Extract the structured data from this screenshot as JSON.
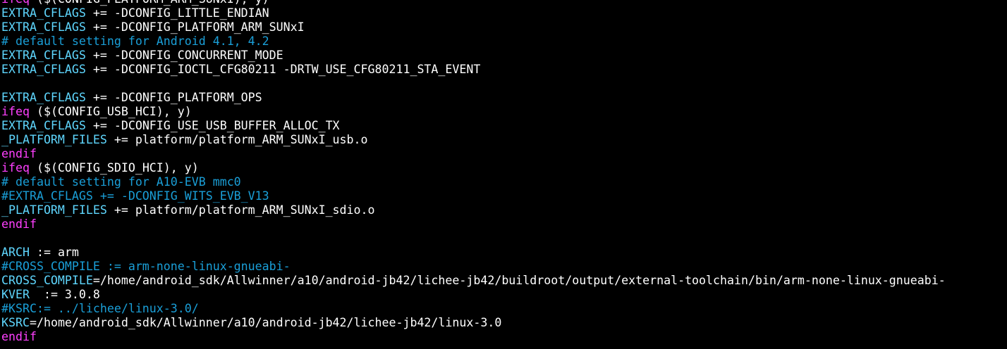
{
  "colors": {
    "background": "#000000",
    "keyword": "#ff40ff",
    "variable": "#5fd7ff",
    "text": "#ffffff",
    "comment": "#1a9fd8"
  },
  "lines": [
    {
      "type": "code",
      "segments": [
        {
          "c": "kw",
          "t": "ifeq"
        },
        {
          "c": "txt",
          "t": " ($(CONFIG_PLATFORM_ARM_SUNxI), y)"
        }
      ]
    },
    {
      "type": "code",
      "segments": [
        {
          "c": "var",
          "t": "EXTRA_CFLAGS"
        },
        {
          "c": "op",
          "t": " += "
        },
        {
          "c": "txt",
          "t": "-DCONFIG_LITTLE_ENDIAN"
        }
      ]
    },
    {
      "type": "code",
      "segments": [
        {
          "c": "var",
          "t": "EXTRA_CFLAGS"
        },
        {
          "c": "op",
          "t": " += "
        },
        {
          "c": "txt",
          "t": "-DCONFIG_PLATFORM_ARM_SUNxI"
        }
      ]
    },
    {
      "type": "code",
      "segments": [
        {
          "c": "cmt",
          "t": "# default setting for Android 4.1, 4.2"
        }
      ]
    },
    {
      "type": "code",
      "segments": [
        {
          "c": "var",
          "t": "EXTRA_CFLAGS"
        },
        {
          "c": "op",
          "t": " += "
        },
        {
          "c": "txt",
          "t": "-DCONFIG_CONCURRENT_MODE"
        }
      ]
    },
    {
      "type": "code",
      "segments": [
        {
          "c": "var",
          "t": "EXTRA_CFLAGS"
        },
        {
          "c": "op",
          "t": " += "
        },
        {
          "c": "txt",
          "t": "-DCONFIG_IOCTL_CFG80211 -DRTW_USE_CFG80211_STA_EVENT"
        }
      ]
    },
    {
      "type": "empty",
      "segments": []
    },
    {
      "type": "code",
      "segments": [
        {
          "c": "var",
          "t": "EXTRA_CFLAGS"
        },
        {
          "c": "op",
          "t": " += "
        },
        {
          "c": "txt",
          "t": "-DCONFIG_PLATFORM_OPS"
        }
      ]
    },
    {
      "type": "code",
      "segments": [
        {
          "c": "kw",
          "t": "ifeq"
        },
        {
          "c": "txt",
          "t": " ($(CONFIG_USB_HCI), y)"
        }
      ]
    },
    {
      "type": "code",
      "segments": [
        {
          "c": "var",
          "t": "EXTRA_CFLAGS"
        },
        {
          "c": "op",
          "t": " += "
        },
        {
          "c": "txt",
          "t": "-DCONFIG_USE_USB_BUFFER_ALLOC_TX"
        }
      ]
    },
    {
      "type": "code",
      "segments": [
        {
          "c": "var",
          "t": "_PLATFORM_FILES"
        },
        {
          "c": "op",
          "t": " += "
        },
        {
          "c": "txt",
          "t": "platform/platform_ARM_SUNxI_usb.o"
        }
      ]
    },
    {
      "type": "code",
      "segments": [
        {
          "c": "kw",
          "t": "endif"
        }
      ]
    },
    {
      "type": "code",
      "segments": [
        {
          "c": "kw",
          "t": "ifeq"
        },
        {
          "c": "txt",
          "t": " ($(CONFIG_SDIO_HCI), y)"
        }
      ]
    },
    {
      "type": "code",
      "segments": [
        {
          "c": "cmt",
          "t": "# default setting for A10-EVB mmc0"
        }
      ]
    },
    {
      "type": "code",
      "segments": [
        {
          "c": "cmt",
          "t": "#EXTRA_CFLAGS += -DCONFIG_WITS_EVB_V13"
        }
      ]
    },
    {
      "type": "code",
      "segments": [
        {
          "c": "var",
          "t": "_PLATFORM_FILES"
        },
        {
          "c": "op",
          "t": " += "
        },
        {
          "c": "txt",
          "t": "platform/platform_ARM_SUNxI_sdio.o"
        }
      ]
    },
    {
      "type": "code",
      "segments": [
        {
          "c": "kw",
          "t": "endif"
        }
      ]
    },
    {
      "type": "empty",
      "segments": []
    },
    {
      "type": "code",
      "segments": [
        {
          "c": "var",
          "t": "ARCH"
        },
        {
          "c": "op",
          "t": " := "
        },
        {
          "c": "txt",
          "t": "arm"
        }
      ]
    },
    {
      "type": "code",
      "segments": [
        {
          "c": "cmt",
          "t": "#CROSS_COMPILE := arm-none-linux-gnueabi-"
        }
      ]
    },
    {
      "type": "code",
      "segments": [
        {
          "c": "var",
          "t": "CROSS_COMPILE"
        },
        {
          "c": "op",
          "t": "="
        },
        {
          "c": "txt",
          "t": "/home/android_sdk/Allwinner/a10/android-jb42/lichee-jb42/buildroot/output/external-toolchain/bin/arm-none-linux-gnueabi-"
        }
      ]
    },
    {
      "type": "code",
      "segments": [
        {
          "c": "var",
          "t": "KVER"
        },
        {
          "c": "op",
          "t": "  := "
        },
        {
          "c": "txt",
          "t": "3.0.8"
        }
      ]
    },
    {
      "type": "code",
      "segments": [
        {
          "c": "cmt",
          "t": "#KSRC:= ../lichee/linux-3.0/"
        }
      ]
    },
    {
      "type": "code",
      "segments": [
        {
          "c": "var",
          "t": "KSRC"
        },
        {
          "c": "op",
          "t": "="
        },
        {
          "c": "txt",
          "t": "/home/android_sdk/Allwinner/a10/android-jb42/lichee-jb42/linux-3.0"
        }
      ]
    },
    {
      "type": "code",
      "segments": [
        {
          "c": "kw",
          "t": "endif"
        }
      ]
    }
  ]
}
